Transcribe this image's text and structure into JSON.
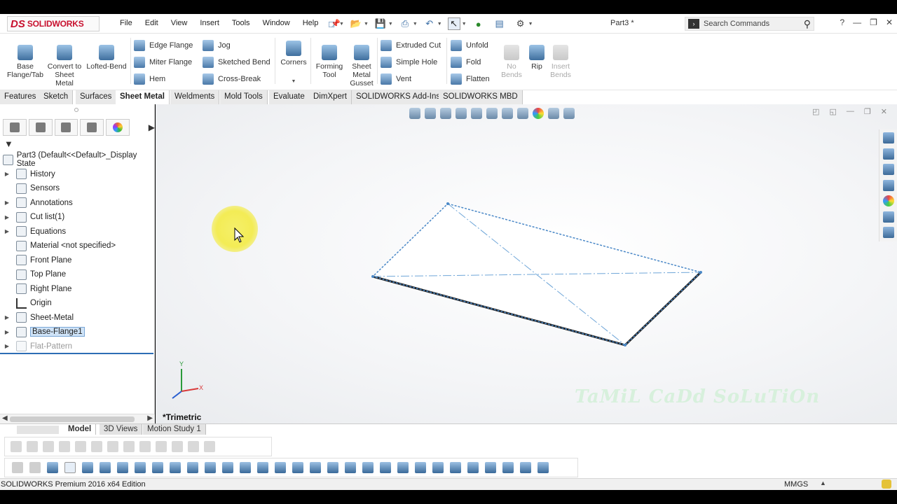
{
  "app": {
    "logo_ds": "DS",
    "logo_name": "SOLIDWORKS",
    "document_title": "Part3 *"
  },
  "menu": [
    "File",
    "Edit",
    "View",
    "Insert",
    "Tools",
    "Window",
    "Help"
  ],
  "search": {
    "placeholder": "Search Commands"
  },
  "ribbon": {
    "base_flange": "Base Flange/Tab",
    "convert": "Convert to Sheet Metal",
    "lofted_bend": "Lofted-Bend",
    "edge_flange": "Edge Flange",
    "miter_flange": "Miter Flange",
    "hem": "Hem",
    "jog": "Jog",
    "sketched_bend": "Sketched Bend",
    "cross_break": "Cross-Break",
    "corners": "Corners",
    "forming_tool": "Forming Tool",
    "gusset": "Sheet Metal Gusset",
    "extruded_cut": "Extruded Cut",
    "simple_hole": "Simple Hole",
    "vent": "Vent",
    "unfold": "Unfold",
    "fold": "Fold",
    "flatten": "Flatten",
    "no_bends": "No Bends",
    "rip": "Rip",
    "insert_bends": "Insert Bends"
  },
  "tabs": [
    {
      "label": "Features",
      "active": false
    },
    {
      "label": "Sketch",
      "active": false
    },
    {
      "label": "Surfaces",
      "active": false
    },
    {
      "label": "Sheet Metal",
      "active": true
    },
    {
      "label": "Weldments",
      "active": false
    },
    {
      "label": "Mold Tools",
      "active": false
    },
    {
      "label": "Evaluate",
      "active": false
    },
    {
      "label": "DimXpert",
      "active": false
    },
    {
      "label": "SOLIDWORKS Add-Ins",
      "active": false
    },
    {
      "label": "SOLIDWORKS MBD",
      "active": false
    }
  ],
  "tree": {
    "root": "Part3  (Default<<Default>_Display State",
    "items": [
      {
        "label": "History",
        "expandable": true
      },
      {
        "label": "Sensors",
        "expandable": false
      },
      {
        "label": "Annotations",
        "expandable": true
      },
      {
        "label": "Cut list(1)",
        "expandable": true
      },
      {
        "label": "Equations",
        "expandable": true
      },
      {
        "label": "Material <not specified>",
        "expandable": false
      },
      {
        "label": "Front Plane",
        "expandable": false
      },
      {
        "label": "Top Plane",
        "expandable": false
      },
      {
        "label": "Right Plane",
        "expandable": false
      },
      {
        "label": "Origin",
        "expandable": false
      },
      {
        "label": "Sheet-Metal",
        "expandable": true
      },
      {
        "label": "Base-Flange1",
        "expandable": true,
        "selected": true
      },
      {
        "label": "Flat-Pattern",
        "expandable": true,
        "dimmed": true
      }
    ]
  },
  "viewport": {
    "view_name": "*Trimetric",
    "watermark": "TaMiL CaDd SoLuTiOn",
    "axis_y": "Y",
    "axis_x": "X"
  },
  "bottom_tabs": [
    "Model",
    "3D Views",
    "Motion Study 1"
  ],
  "status": {
    "edition": "SOLIDWORKS Premium 2016 x64 Edition",
    "units": "MMGS"
  },
  "colors": {
    "accent": "#2d6db5",
    "brand_red": "#c8102e",
    "model_edge": "#4a88c7",
    "highlight_yellow": "#f3ec55"
  }
}
